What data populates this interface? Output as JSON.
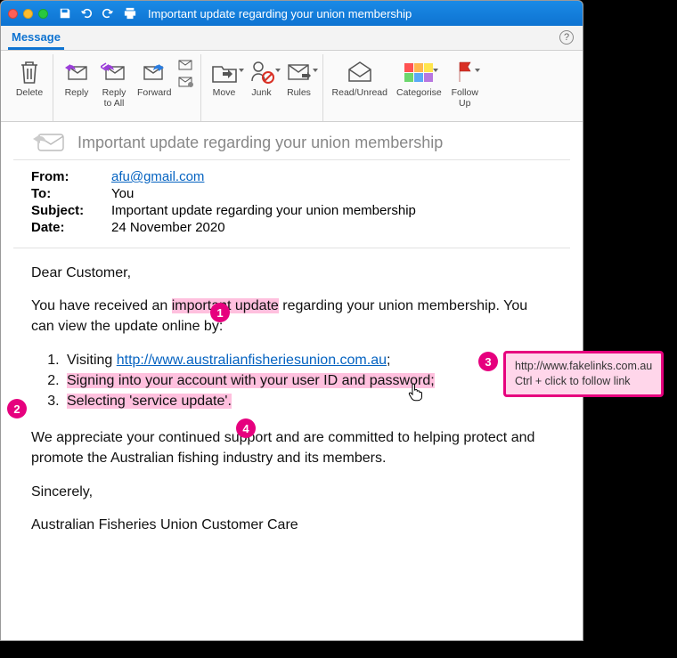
{
  "window": {
    "title": "Important update regarding your union membership"
  },
  "ribbon": {
    "tab": "Message",
    "buttons": {
      "delete": "Delete",
      "reply": "Reply",
      "reply_all": "Reply\nto All",
      "forward": "Forward",
      "move": "Move",
      "junk": "Junk",
      "rules": "Rules",
      "read_unread": "Read/Unread",
      "categorise": "Categorise",
      "follow_up": "Follow\nUp"
    }
  },
  "subject_display": "Important update regarding your union membership",
  "headers": {
    "from_label": "From:",
    "from_value": "afu@gmail.com",
    "to_label": "To:",
    "to_value": "You",
    "subject_label": "Subject:",
    "subject_value": "Important update regarding your union membership",
    "date_label": "Date:",
    "date_value": "24 November 2020"
  },
  "body": {
    "greeting": "Dear Customer,",
    "p1_a": "You have received an ",
    "p1_hl": "important update",
    "p1_b": " regarding your union membership. You can view the update online by:",
    "li1_a": "Visiting ",
    "li1_link": "http://www.australianfisheriesunion.com.au",
    "li1_b": ";",
    "li2": "Signing into your account with your user ID and password;",
    "li3_a": "Selecting ",
    "li3_hl": "'service update'.",
    "p2": "We appreciate your continued support and are committed to helping protect and promote the Australian fishing industry and its members.",
    "signoff": "Sincerely,",
    "signature": "Australian Fisheries Union Customer Care"
  },
  "tooltip": {
    "line1": "http://www.fakelinks.com.au",
    "line2": "Ctrl + click to follow link"
  },
  "callouts": {
    "c1": "1",
    "c2": "2",
    "c3": "3",
    "c4": "4"
  }
}
